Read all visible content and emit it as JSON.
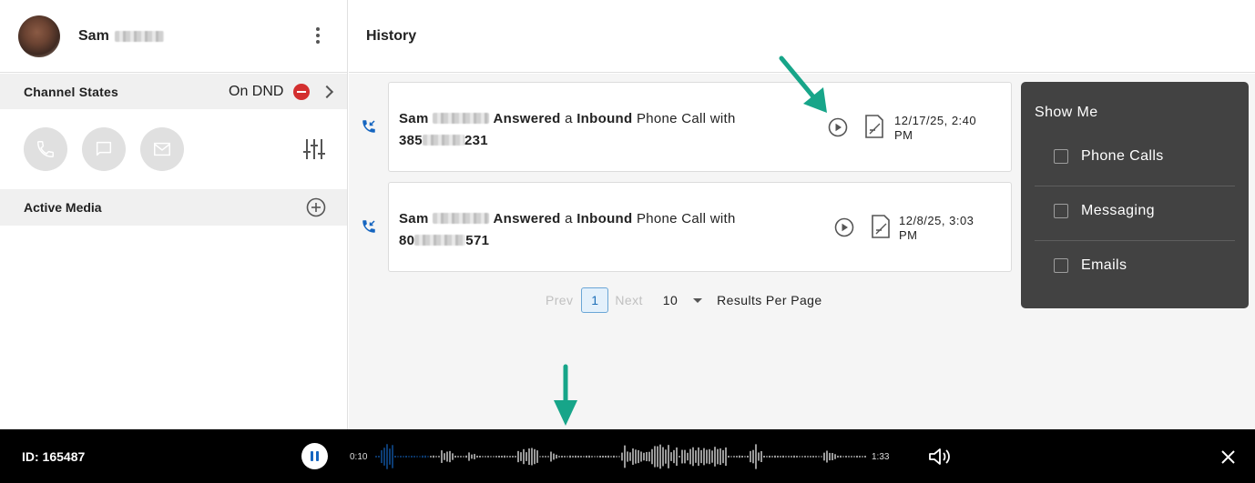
{
  "user": {
    "first_name": "Sam"
  },
  "channel_states": {
    "label": "Channel States",
    "status": "On DND"
  },
  "active_media": {
    "label": "Active Media"
  },
  "history": {
    "title": "History",
    "entries": [
      {
        "agent_first": "Sam",
        "action": "Answered",
        "a": "a",
        "direction": "Inbound",
        "channel": "Phone Call with",
        "number_prefix": "385",
        "number_suffix": "231",
        "time_line1": "12/17/25, 2:40",
        "time_line2": "PM"
      },
      {
        "agent_first": "Sam",
        "action": "Answered",
        "a": "a",
        "direction": "Inbound",
        "channel": "Phone Call with",
        "number_prefix": "80",
        "number_suffix": "571",
        "time_line1": "12/8/25, 3:03",
        "time_line2": "PM"
      }
    ]
  },
  "pagination": {
    "prev": "Prev",
    "current": "1",
    "next": "Next",
    "page_size": "10",
    "results_label": "Results Per Page"
  },
  "show_me": {
    "title": "Show Me",
    "options": [
      {
        "label": "Phone Calls",
        "checked": false
      },
      {
        "label": "Messaging",
        "checked": false
      },
      {
        "label": "Emails",
        "checked": false
      }
    ]
  },
  "player": {
    "id_label": "ID: 165487",
    "current_time": "0:10",
    "total_time": "1:33",
    "progress": 0.11
  },
  "colors": {
    "accent": "#1565c0",
    "annotation_arrow": "#17a589",
    "dnd_red": "#d32f2f",
    "panel_dark": "#424242"
  }
}
